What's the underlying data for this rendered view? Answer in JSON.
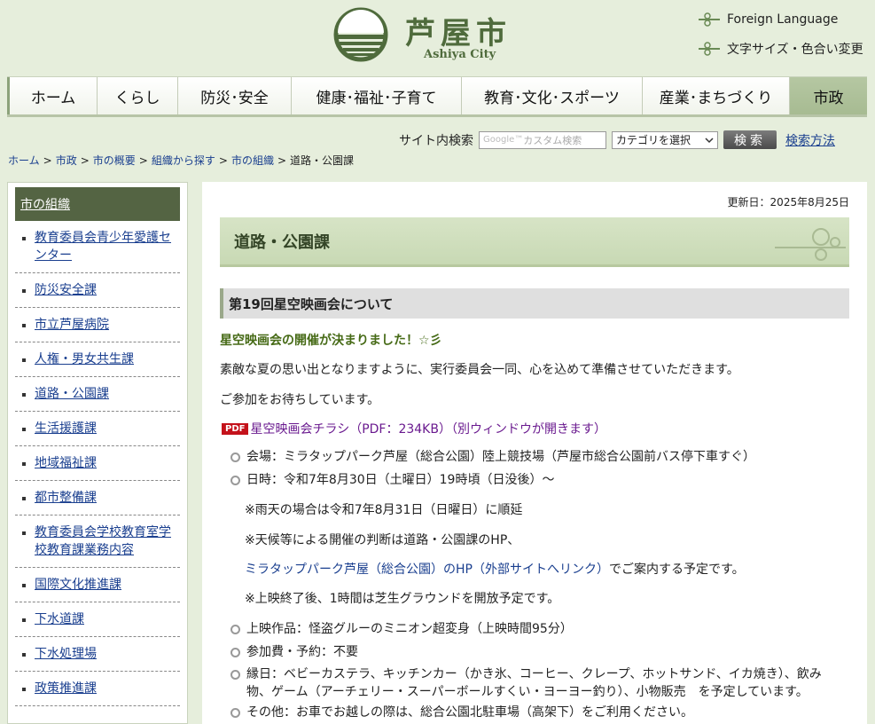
{
  "header": {
    "logo_title": "芦屋市",
    "logo_sub": "Ashiya City",
    "foreign_language": "Foreign Language",
    "text_size": "文字サイズ・色合い変更"
  },
  "nav": {
    "items": [
      "ホーム",
      "くらし",
      "防災･安全",
      "健康･福祉･子育て",
      "教育･文化･スポーツ",
      "産業･まちづくり",
      "市政"
    ]
  },
  "search": {
    "label": "サイト内検索",
    "placeholder": "カスタム検索",
    "google_mark": "Google™",
    "category": "カテゴリを選択",
    "button": "検索",
    "help": "検索方法"
  },
  "breadcrumb": {
    "items": [
      "ホーム",
      "市政",
      "市の概要",
      "組織から探す",
      "市の組織"
    ],
    "current": "道路・公園課",
    "sep": ">"
  },
  "sidebar": {
    "title": "市の組織",
    "items": [
      "教育委員会青少年愛護センター",
      "防災安全課",
      "市立芦屋病院",
      "人権・男女共生課",
      "道路・公園課",
      "生活援護課",
      "地域福祉課",
      "都市整備課",
      "教育委員会学校教育室学校教育課業務内容",
      "国際文化推進課",
      "下水道課",
      "下水処理場",
      "政策推進課"
    ]
  },
  "main": {
    "updated": "更新日：2025年8月25日",
    "page_title": "道路・公園課",
    "section_title": "第19回星空映画会について",
    "lead": "星空映画会の開催が決まりました！☆彡",
    "para1": "素敵な夏の思い出となりますように、実行委員会一同、心を込めて準備させていただきます。",
    "para2": "ご参加をお待ちしています。",
    "pdf_badge": "PDF",
    "pdf_link": "星空映画会チラシ（PDF：234KB）（別ウィンドウが開きます）",
    "venue": "会場：ミラタップパーク芦屋（総合公園）陸上競技場（芦屋市総合公園前バス停下車すぐ）",
    "date": "日時：令和7年8月30日（土曜日）19時頃（日没後）〜",
    "rain": "※雨天の場合は令和7年8月31日（日曜日）に順延",
    "weather": "※天候等による開催の判断は道路・公園課のHP、",
    "park_link": "ミラタップパーク芦屋（総合公園）のHP（外部サイトへリンク）",
    "park_suffix": "でご案内する予定です。",
    "lawn": "※上映終了後、1時間は芝生グラウンドを開放予定です。",
    "film": "上映作品：怪盗グルーのミニオン超変身（上映時間95分）",
    "fee": "参加費・予約：不要",
    "stalls": "縁日：ベビーカステラ、キッチンカー（かき氷、コーヒー、クレープ、ホットサンド、イカ焼き）、飲み物、ゲーム（アーチェリー・スーパーボールすくい・ヨーヨー釣り）、小物販売　を予定しています。",
    "other": "その他：お車でお越しの際は、総合公園北駐車場（高架下）をご利用ください。"
  }
}
